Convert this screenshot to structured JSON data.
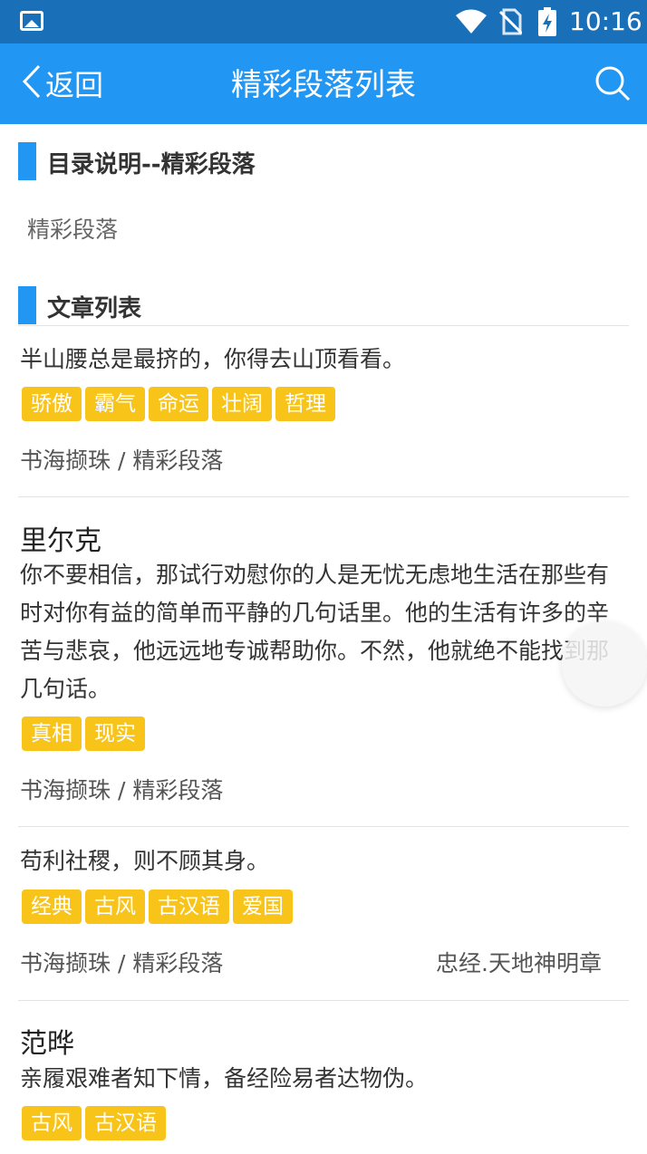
{
  "status_bar": {
    "time": "10:16",
    "icons": [
      "image-icon",
      "wifi-icon",
      "no-sim-icon",
      "battery-charging-icon"
    ]
  },
  "nav": {
    "back_label": "返回",
    "title": "精彩段落列表",
    "icons": [
      "chevron-left-icon",
      "search-icon"
    ]
  },
  "catalog": {
    "heading": "目录说明--精彩段落",
    "description": "精彩段落"
  },
  "articles": {
    "heading": "文章列表",
    "items": [
      {
        "title": "",
        "text": "半山腰总是最挤的，你得去山顶看看。",
        "tags": [
          "骄傲",
          "霸气",
          "命运",
          "壮阔",
          "哲理"
        ],
        "source": "书海撷珠 / 精彩段落",
        "author": ""
      },
      {
        "title": "里尔克",
        "text": " 你不要相信，那试行劝慰你的人是无忧无虑地生活在那些有时对你有益的简单而平静的几句话里。他的生活有许多的辛苦与悲哀，他远远地专诚帮助你。不然，他就绝不能找到那几句话。",
        "tags": [
          "真相",
          "现实"
        ],
        "source": "书海撷珠 / 精彩段落",
        "author": ""
      },
      {
        "title": "",
        "text": " 苟利社稷，则不顾其身。",
        "tags": [
          "经典",
          "古风",
          "古汉语",
          "爱国"
        ],
        "source": "书海撷珠 / 精彩段落",
        "author": "忠经.天地神明章"
      },
      {
        "title": "范晔",
        "text": " 亲履艰难者知下情，备经险易者达物伪。",
        "tags": [
          "古风",
          "古汉语"
        ],
        "source": "",
        "author": ""
      }
    ]
  },
  "colors": {
    "status_bar": "#1a6fb9",
    "nav_bar": "#2196f3",
    "section_accent": "#2196f3",
    "tag_background": "#f8c419"
  }
}
